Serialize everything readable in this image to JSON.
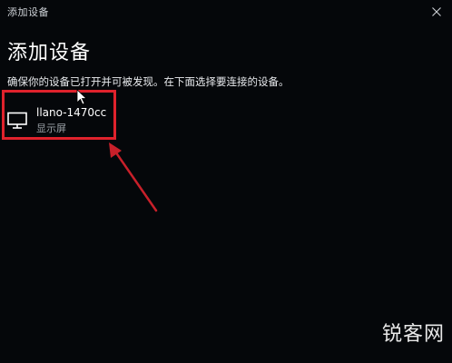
{
  "window": {
    "title": "添加设备",
    "close_icon": "close-icon"
  },
  "main": {
    "heading": "添加设备",
    "instruction": "确保你的设备已打开并可被发现。在下面选择要连接的设备。"
  },
  "devices": [
    {
      "name": "llano-1470cc",
      "type": "显示屏",
      "icon": "monitor-icon"
    }
  ],
  "annotation": {
    "box_color": "#e0222c",
    "arrow_color": "#c8202a"
  },
  "watermark": {
    "text": "锐客网"
  }
}
